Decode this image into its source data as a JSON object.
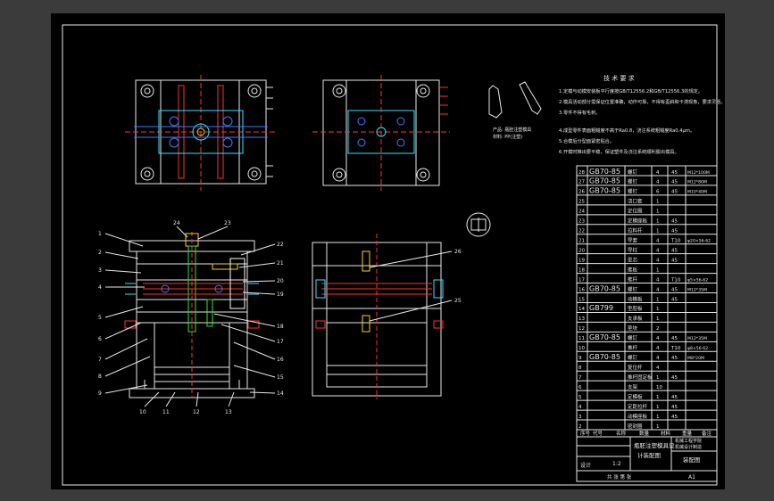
{
  "tech_req": {
    "title": "技 术 要 求",
    "lines": [
      "1.定模与动模安装板平行度按GB/T12556.2和GB/T12556.3的规定。",
      "2.模具活动部分需保证位置准确，动作可靠，不得有歪斜和卡滞现象，要求灵活。",
      "3.零件不得有毛刺。",
      "4.成型零件表面粗糙度不高于Ra0.8，浇注系统粗糙度Ra0.4μm。",
      "5.合模后分型面紧密贴合。",
      "6.开模时推出要平稳，保证塑件及浇注系统顺利脱出模具。"
    ]
  },
  "part_note": {
    "line1": "产品: 瓶胚注塑模具",
    "line2": "材料: PP(注塑)"
  },
  "balloons_left": [
    "1",
    "2",
    "3",
    "4",
    "5",
    "6",
    "7",
    "8",
    "9"
  ],
  "balloons_right": [
    "22",
    "21",
    "20",
    "19",
    "18",
    "17",
    "16",
    "15",
    "14"
  ],
  "balloons_bottom": [
    "10",
    "11",
    "12",
    "13"
  ],
  "balloons_top": [
    "24",
    "23"
  ],
  "balloons_section": [
    "26",
    "25"
  ],
  "bom": [
    {
      "no": "28",
      "std": "GB70-85",
      "name": "螺钉",
      "qty": "4",
      "mat": "45",
      "note": "M12*100M"
    },
    {
      "no": "27",
      "std": "GB70-85",
      "name": "螺钉",
      "qty": "4",
      "mat": "45",
      "note": "M12*80M"
    },
    {
      "no": "26",
      "std": "GB70-85",
      "name": "螺钉",
      "qty": "6",
      "mat": "45",
      "note": "M10*40M"
    },
    {
      "no": "25",
      "std": "",
      "name": "浇口套",
      "qty": "1",
      "mat": "",
      "note": ""
    },
    {
      "no": "24",
      "std": "",
      "name": "定位圈",
      "qty": "1",
      "mat": "",
      "note": ""
    },
    {
      "no": "23",
      "std": "",
      "name": "定模座板",
      "qty": "1",
      "mat": "45",
      "note": ""
    },
    {
      "no": "22",
      "std": "",
      "name": "拉料杆",
      "qty": "1",
      "mat": "45",
      "note": ""
    },
    {
      "no": "21",
      "std": "",
      "name": "导套",
      "qty": "4",
      "mat": "T10",
      "note": "φ20×56-62"
    },
    {
      "no": "20",
      "std": "",
      "name": "导柱",
      "qty": "4",
      "mat": "45",
      "note": ""
    },
    {
      "no": "19",
      "std": "",
      "name": "型芯",
      "qty": "4",
      "mat": "45",
      "note": ""
    },
    {
      "no": "18",
      "std": "",
      "name": "推板",
      "qty": "1",
      "mat": "",
      "note": ""
    },
    {
      "no": "17",
      "std": "",
      "name": "推杆",
      "qty": "4",
      "mat": "T10",
      "note": "φ5×56-62"
    },
    {
      "no": "16",
      "std": "GB70-85",
      "name": "螺钉",
      "qty": "4",
      "mat": "45",
      "note": "M12*35M"
    },
    {
      "no": "15",
      "std": "",
      "name": "动模板",
      "qty": "1",
      "mat": "45",
      "note": ""
    },
    {
      "no": "14",
      "std": "GB799",
      "name": "型腔板",
      "qty": "1",
      "mat": "",
      "note": ""
    },
    {
      "no": "13",
      "std": "",
      "name": "支承板",
      "qty": "1",
      "mat": "",
      "note": ""
    },
    {
      "no": "12",
      "std": "",
      "name": "垫块",
      "qty": "2",
      "mat": "",
      "note": ""
    },
    {
      "no": "11",
      "std": "GB70-85",
      "name": "螺钉",
      "qty": "4",
      "mat": "45",
      "note": "M12*35M"
    },
    {
      "no": "10",
      "std": "",
      "name": "推杆",
      "qty": "4",
      "mat": "T10",
      "note": "φ8×56-62"
    },
    {
      "no": "9",
      "std": "GB70-85",
      "name": "螺钉",
      "qty": "4",
      "mat": "45",
      "note": "M8*20M"
    },
    {
      "no": "8",
      "std": "",
      "name": "复位杆",
      "qty": "4",
      "mat": "",
      "note": ""
    },
    {
      "no": "7",
      "std": "",
      "name": "推杆固定板",
      "qty": "1",
      "mat": "45",
      "note": ""
    },
    {
      "no": "6",
      "std": "",
      "name": "支架",
      "qty": "10",
      "mat": "",
      "note": ""
    },
    {
      "no": "5",
      "std": "",
      "name": "定模板",
      "qty": "1",
      "mat": "45",
      "note": ""
    },
    {
      "no": "4",
      "std": "",
      "name": "定距拉杆",
      "qty": "1",
      "mat": "45",
      "note": ""
    },
    {
      "no": "3",
      "std": "",
      "name": "动模座板",
      "qty": "1",
      "mat": "45",
      "note": ""
    },
    {
      "no": "2",
      "std": "",
      "name": "密封圈",
      "qty": "1",
      "mat": "",
      "note": ""
    }
  ],
  "title_block": {
    "header": [
      "序号",
      "代号",
      "名称",
      "数量",
      "材料",
      "重量",
      "备注"
    ],
    "drawing_name_line1": "瓶胚注塑模具设",
    "drawing_name_line2": "计装配图",
    "school_line1": "机械工程学院",
    "school_line2": "机械设计制造",
    "drawing_no": "装配图",
    "sheet_size": "A1",
    "scale": "1:2",
    "designer_label": "设计",
    "sheet_info": "共 张 第 张"
  },
  "colors": {
    "sheet": "#000000",
    "paper": "#3b3b3b",
    "lines": "#e8e8e8",
    "red": "#ff3030",
    "cyan": "#2fe3ff",
    "blue": "#3a7bff",
    "yellow": "#ffd400",
    "green": "#2ce62c",
    "teal": "#2a9ab0"
  }
}
